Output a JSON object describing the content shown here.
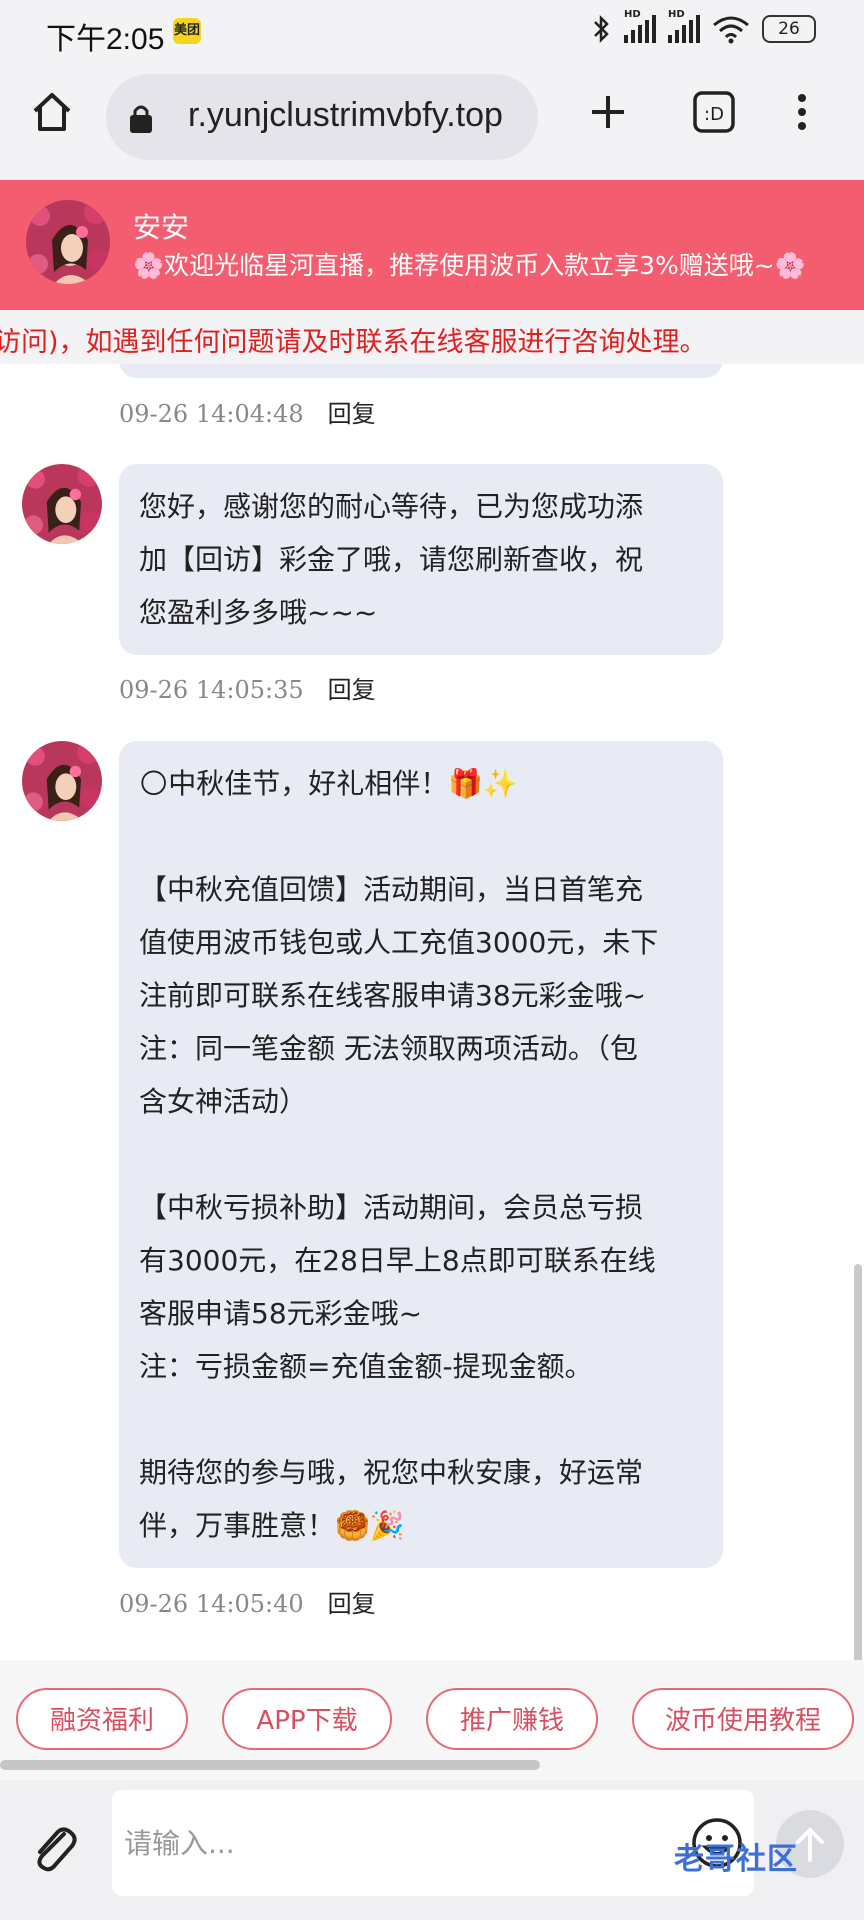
{
  "status_bar": {
    "time": "下午2:05",
    "app_badge": "美团",
    "battery": "26"
  },
  "browser": {
    "url": "r.yunjclustrimvbfy.top"
  },
  "header": {
    "name": "安安",
    "welcome": "🌸欢迎光临星河直播，推荐使用波币入款立享3%赠送哦~🌸"
  },
  "notice": {
    "text": "访问)，如遇到任何问题请及时联系在线客服进行咨询处理。"
  },
  "messages": [
    {
      "text_lines": [],
      "time": "09-26 14:04:48",
      "reply": "回复"
    },
    {
      "text_lines": [
        "您好，感谢您的耐心等待，已为您成功添",
        "加【回访】彩金了哦，请您刷新查收，祝",
        "您盈利多多哦~~~"
      ],
      "time": "09-26 14:05:35",
      "reply": "回复"
    },
    {
      "text_lines": [
        "🌕中秋佳节，好礼相伴！🎁✨",
        "",
        "【中秋充值回馈】活动期间，当日首笔充",
        "值使用波币钱包或人工充值3000元，未下",
        "注前即可联系在线客服申请38元彩金哦~",
        "注：同一笔金额 无法领取两项活动。（包",
        "含女神活动）",
        "",
        "【中秋亏损补助】活动期间，会员总亏损",
        "有3000元，在28日早上8点即可联系在线",
        "客服申请58元彩金哦~",
        "注：亏损金额=充值金额-提现金额。",
        "",
        "期待您的参与哦，祝您中秋安康，好运常",
        "伴，万事胜意！🥮🎉"
      ],
      "time": "09-26 14:05:40",
      "reply": "回复"
    }
  ],
  "quick_buttons": [
    "融资福利",
    "APP下载",
    "推广赚钱",
    "波币使用教程"
  ],
  "input": {
    "placeholder": "请输入..."
  },
  "watermark": "老哥社区",
  "colors": {
    "header_bg": "#f45d6f",
    "bubble_bg": "#e8ebf3",
    "notice_text": "#e02020",
    "button_border": "#e46a78"
  }
}
